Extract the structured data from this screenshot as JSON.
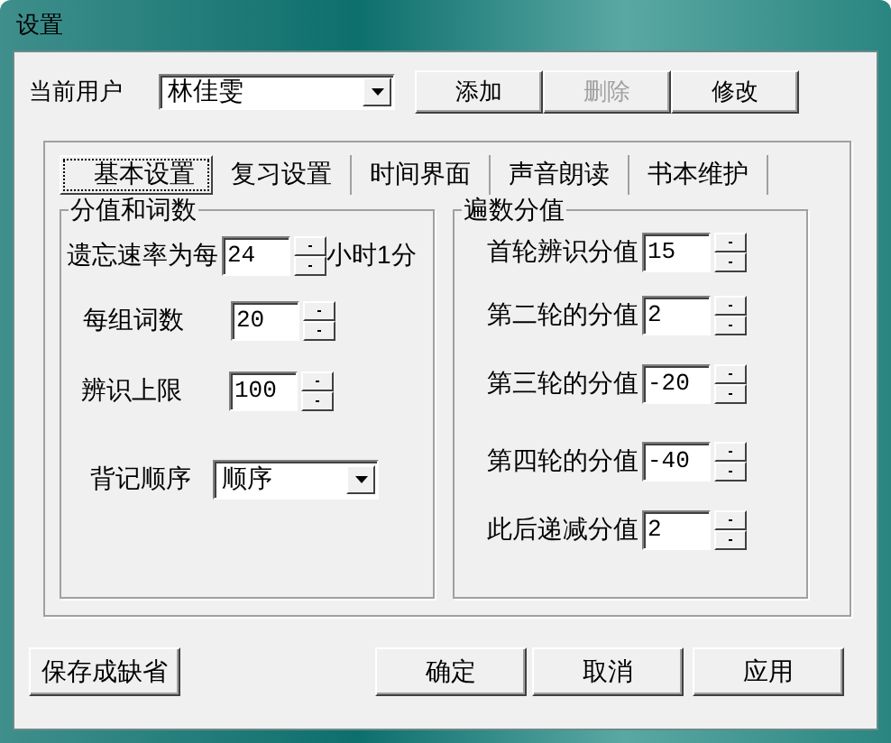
{
  "window": {
    "title": "设置"
  },
  "user": {
    "label": "当前用户",
    "value": "林佳雯"
  },
  "user_buttons": [
    {
      "label": "添加",
      "disabled": false
    },
    {
      "label": "删除",
      "disabled": true
    },
    {
      "label": "修改",
      "disabled": false
    }
  ],
  "tabs": [
    {
      "label": "基本设置",
      "selected": true
    },
    {
      "label": "复习设置",
      "selected": false
    },
    {
      "label": "时间界面",
      "selected": false
    },
    {
      "label": "声音朗读",
      "selected": false
    },
    {
      "label": "书本维护",
      "selected": false
    }
  ],
  "groups": [
    {
      "title": "分值和词数",
      "rows": [
        {
          "kind": "spinner",
          "label": "遗忘速率为每",
          "value": "24",
          "suffix": "小时1分"
        },
        {
          "kind": "spinner",
          "label": "每组词数",
          "value": "20"
        },
        {
          "kind": "spinner",
          "label": "辨识上限",
          "value": "100"
        },
        {
          "kind": "select",
          "label": "背记顺序",
          "value": "顺序"
        }
      ]
    },
    {
      "title": "遍数分值",
      "rows": [
        {
          "kind": "spinner",
          "label": "首轮辨识分值",
          "value": "15"
        },
        {
          "kind": "spinner",
          "label": "第二轮的分值",
          "value": "2"
        },
        {
          "kind": "spinner",
          "label": "第三轮的分值",
          "value": "-20"
        },
        {
          "kind": "spinner",
          "label": "第四轮的分值",
          "value": "-40"
        },
        {
          "kind": "spinner",
          "label": "此后递减分值",
          "value": "2"
        }
      ]
    }
  ],
  "buttons": [
    {
      "label": "保存成缺省"
    },
    {
      "label": "确定"
    },
    {
      "label": "取消"
    },
    {
      "label": "应用"
    }
  ]
}
